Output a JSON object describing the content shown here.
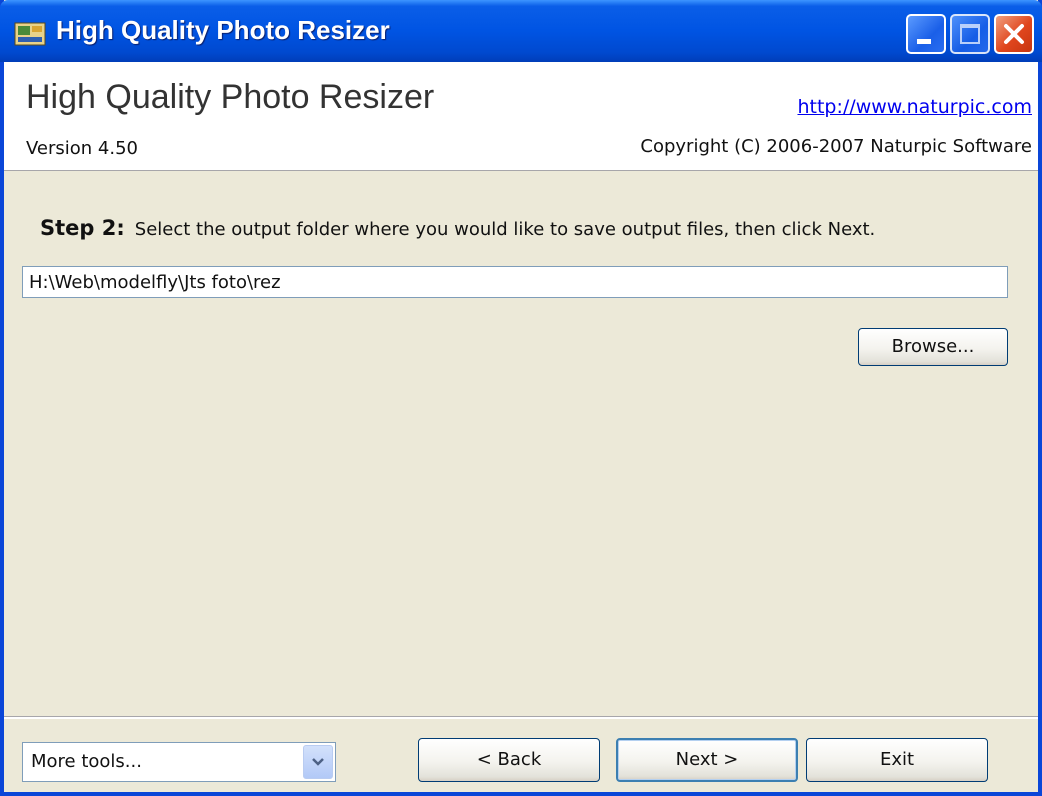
{
  "window": {
    "title": "High Quality Photo Resizer"
  },
  "header": {
    "title": "High Quality Photo Resizer",
    "link": "http://www.naturpic.com",
    "version": "Version 4.50",
    "copyright": "Copyright (C) 2006-2007 Naturpic Software"
  },
  "step": {
    "label": "Step 2:",
    "instruction": "Select the output folder where you would like to save output files, then click Next."
  },
  "output_folder": {
    "value": "H:\\Web\\modelfly\\Jts foto\\rez"
  },
  "buttons": {
    "browse": "Browse...",
    "back": "< Back",
    "next": "Next >",
    "exit": "Exit"
  },
  "more_tools": {
    "selected": "More tools..."
  },
  "colors": {
    "titlebar": "#0054e3",
    "face": "#ece9d8",
    "link": "#0000ee",
    "close_button": "#e0461d"
  },
  "icons": {
    "app": "resizer-app-icon",
    "minimize": "minimize-icon",
    "maximize": "maximize-icon",
    "close": "close-icon",
    "dropdown": "chevron-down-icon"
  }
}
